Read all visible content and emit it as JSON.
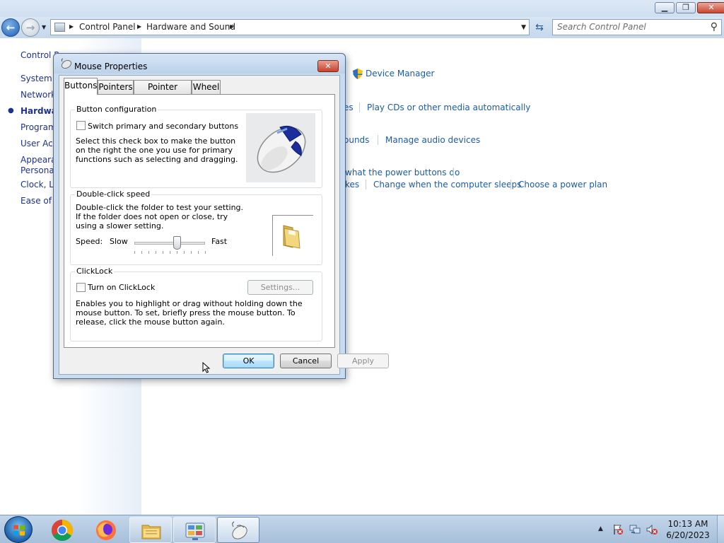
{
  "explorer": {
    "breadcrumb": [
      "Control Panel",
      "Hardware and Sound"
    ],
    "search": {
      "placeholder": "Search Control Panel"
    },
    "left_pane": [
      {
        "label": "Control P"
      },
      {
        "label": "System a"
      },
      {
        "label": "Network"
      },
      {
        "label": "Hardwar",
        "active": true
      },
      {
        "label": "Program"
      },
      {
        "label": "User Acc"
      },
      {
        "label": "Appeara"
      },
      {
        "label": "Personal"
      },
      {
        "label": "Clock, La"
      },
      {
        "label": "Ease of A"
      }
    ],
    "links": {
      "device_manager": "Device Manager",
      "es": "es",
      "play_cds": "Play CDs or other media automatically",
      "ounds": "ounds",
      "manage_audio": "Manage audio devices",
      "power_buttons": "what the power buttons do",
      "kes": "kes",
      "computer_sleeps": "Change when the computer sleeps",
      "power_plan": "Choose a power plan"
    }
  },
  "dialog": {
    "title": "Mouse Properties",
    "tabs": [
      "Buttons",
      "Pointers",
      "Pointer Options",
      "Wheel"
    ],
    "active_tab": "Buttons",
    "button_config": {
      "label": "Button configuration",
      "checkbox_label": "Switch primary and secondary buttons",
      "checked": false,
      "description": "Select this check box to make the button on the right the one you use for primary functions such as selecting and dragging."
    },
    "double_click": {
      "label": "Double-click speed",
      "description": "Double-click the folder to test your setting. If the folder does not open or close, try using a slower setting.",
      "speed_label": "Speed:",
      "slow_label": "Slow",
      "fast_label": "Fast",
      "speed_value": 0.6
    },
    "clicklock": {
      "label": "ClickLock",
      "checkbox_label": "Turn on ClickLock",
      "checked": false,
      "settings_label": "Settings...",
      "description": "Enables you to highlight or drag without holding down the mouse button. To set, briefly press the mouse button. To release, click the mouse button again."
    },
    "buttons": {
      "ok": "OK",
      "cancel": "Cancel",
      "apply": "Apply"
    }
  },
  "taskbar": {
    "clock_time": "10:13 AM",
    "clock_date": "6/20/2023",
    "apps": [
      "chrome-icon",
      "firefox-icon",
      "file-explorer-icon",
      "control-panel-icon",
      "mouse-properties-icon"
    ]
  }
}
